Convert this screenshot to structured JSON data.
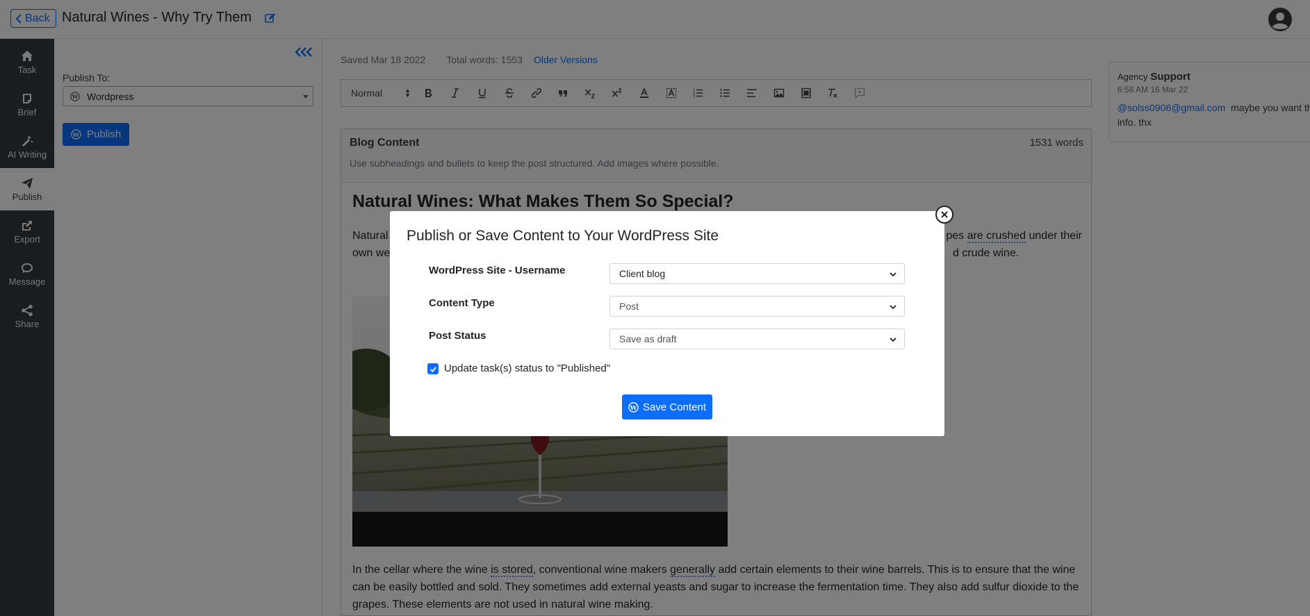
{
  "header": {
    "back_label": "Back",
    "title": "Natural Wines - Why Try Them",
    "icons": [
      "chevron-left-icon",
      "edit-icon",
      "user-avatar-icon"
    ]
  },
  "leftnav": {
    "items": [
      {
        "label": "Task",
        "icon": "home-icon"
      },
      {
        "label": "Brief",
        "icon": "brief-icon"
      },
      {
        "label": "AI Writing",
        "icon": "magic-wand-icon"
      },
      {
        "label": "Publish",
        "icon": "paper-plane-icon",
        "active": true
      },
      {
        "label": "Export",
        "icon": "export-icon"
      },
      {
        "label": "Message",
        "icon": "chat-icon"
      },
      {
        "label": "Share",
        "icon": "share-icon"
      }
    ]
  },
  "publish_panel": {
    "label": "Publish To:",
    "selected": "Wordpress",
    "button_label": "Publish"
  },
  "editor": {
    "saved": "Saved Mar 18 2022",
    "total_words": "Total words: 1553",
    "older_versions": "Older Versions",
    "toolbar_format": "Normal",
    "section_title": "Blog Content",
    "word_count": "1531 words",
    "hint": "Use subheadings and bullets to keep the post structured. Add images where possible.",
    "heading": "Natural Wines: What Makes Them So Special?",
    "p1_start": "Natural",
    "p1_end_a": "pes ",
    "p1_link1": "are crushed",
    "p1_end_b": " under their",
    "p1_line2_start": "own we",
    "p1_line2_end": "d crude wine.",
    "p2_a": "In the cellar where the wine ",
    "p2_link1": "is stored",
    "p2_b": ", conventional wine makers ",
    "p2_link2": "generally",
    "p2_c": " add certain elements to their wine barrels. This is to ensure that the wine can be easily bottled and sold. They sometimes add external yeasts and sugar to increase the fermentation time. They also add sulfur dioxide to the grapes. These elements are not used in natural wine making."
  },
  "comment": {
    "role": "Agency",
    "name": "Support",
    "time": "6:58 AM 16 Mar 22",
    "mention": "@solss0906@gmail.com",
    "text": "maybe you want the info. thx"
  },
  "modal": {
    "title": "Publish or Save Content to Your WordPress Site",
    "site_label": "WordPress Site - Username",
    "site_value": "Client blog",
    "type_label": "Content Type",
    "type_value": "Post",
    "status_label": "Post Status",
    "status_value": "Save as draft",
    "checkbox_label": "Update task(s) status to \"Published\"",
    "save_label": "Save Content"
  },
  "colors": {
    "accent": "#0d6efd",
    "sidebar": "#343a40",
    "overlay": "rgba(0,0,0,0.5)"
  }
}
